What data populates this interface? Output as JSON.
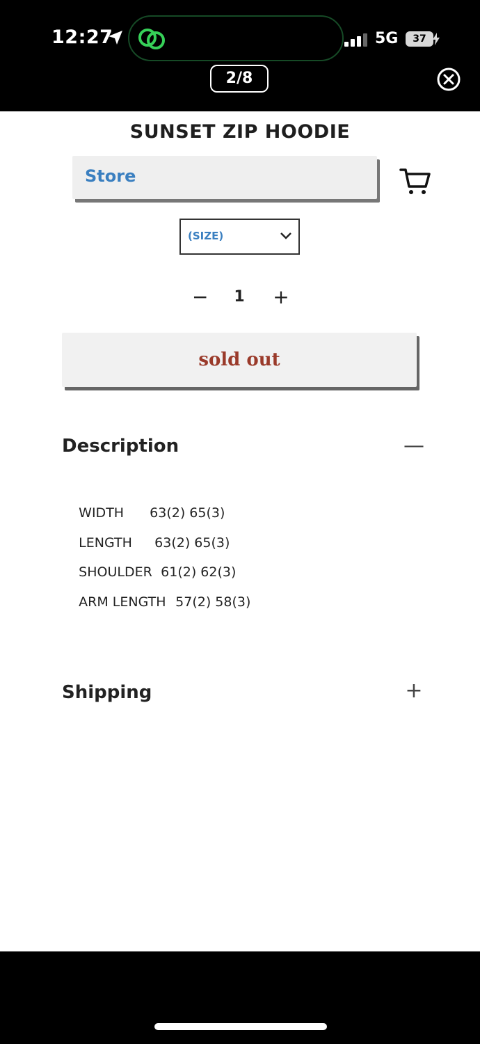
{
  "status_bar": {
    "time": "12:27",
    "network": "5G",
    "battery": "37"
  },
  "viewer": {
    "counter": "2/8"
  },
  "product": {
    "title": "SUNSET ZIP HOODIE",
    "store_label": "Store",
    "size_placeholder": "(SIZE)",
    "quantity": "1",
    "quantity_minus": "−",
    "quantity_plus": "+",
    "sold_out_label": "sold out"
  },
  "description": {
    "title": "Description",
    "toggle": "—",
    "rows": [
      {
        "label": "WIDTH",
        "value": "63(2) 65(3)"
      },
      {
        "label": "LENGTH",
        "value": "63(2) 65(3)"
      },
      {
        "label": "SHOULDER",
        "value": "61(2) 62(3)"
      },
      {
        "label": "ARM LENGTH",
        "value": "57(2) 58(3)"
      }
    ]
  },
  "shipping": {
    "title": "Shipping",
    "toggle": "+"
  }
}
